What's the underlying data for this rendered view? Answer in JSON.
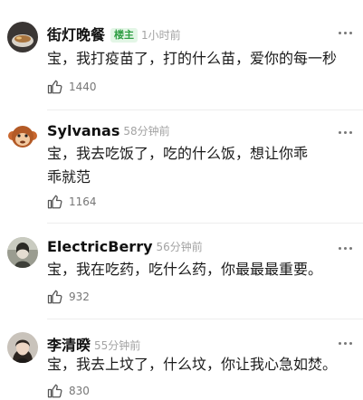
{
  "comments": [
    {
      "username": "街灯晚餐",
      "badge": "楼主",
      "time": "1小时前",
      "text": "宝，我打疫苗了，打的什么苗，爱你的每一秒",
      "likes": "1440",
      "avatar_icon": "bowl-avatar"
    },
    {
      "username": "Sylvanas",
      "badge": "",
      "time": "58分钟前",
      "text": "宝，我去吃饭了，吃的什么饭，想让你乖乖就范",
      "likes": "1164",
      "avatar_icon": "monkey-avatar"
    },
    {
      "username": "ElectricBerry",
      "badge": "",
      "time": "56分钟前",
      "text": "宝，我在吃药，吃什么药，你最最最重要。",
      "likes": "932",
      "avatar_icon": "person-avatar"
    },
    {
      "username": "李清暌",
      "badge": "",
      "time": "55分钟前",
      "text": "宝，我去上坟了，什么坟，你让我心急如焚。",
      "likes": "830",
      "avatar_icon": "portrait-avatar"
    }
  ],
  "icons": {
    "like": "thumbs-up-icon",
    "more": "more-dots-icon"
  }
}
